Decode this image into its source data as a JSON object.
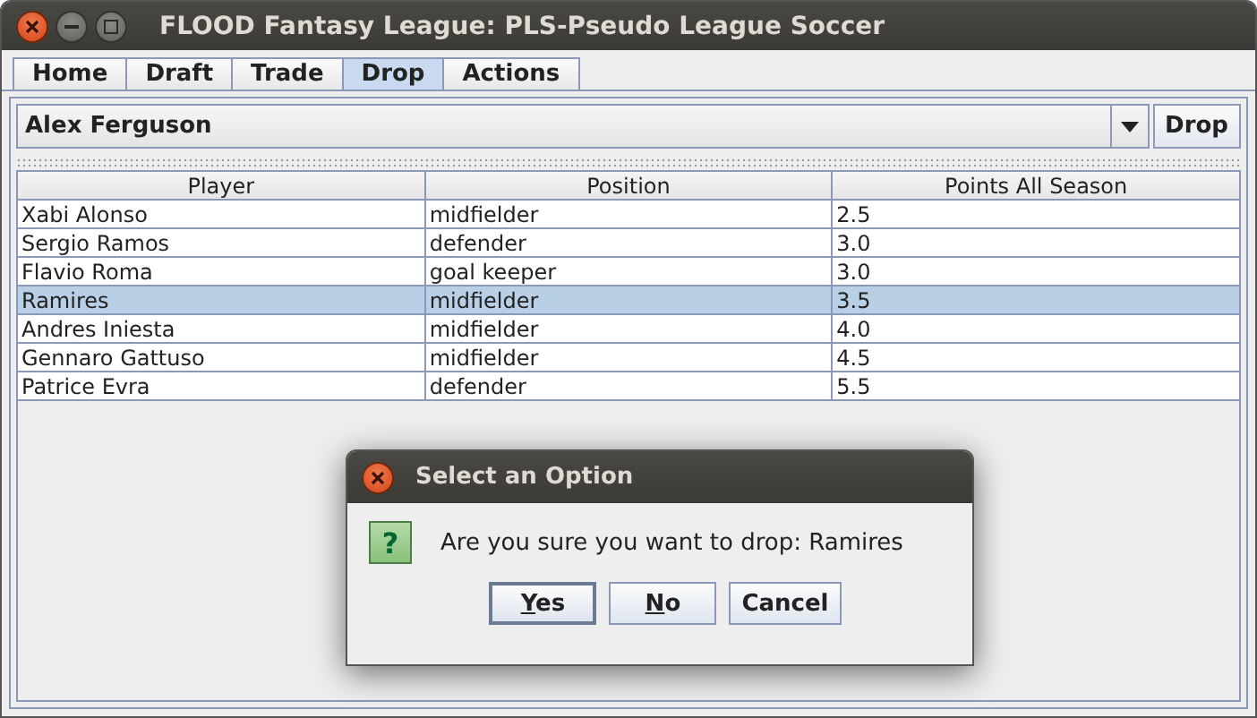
{
  "window": {
    "title": "FLOOD Fantasy League: PLS-Pseudo League Soccer"
  },
  "tabs": [
    {
      "label": "Home",
      "selected": false
    },
    {
      "label": "Draft",
      "selected": false
    },
    {
      "label": "Trade",
      "selected": false
    },
    {
      "label": "Drop",
      "selected": true
    },
    {
      "label": "Actions",
      "selected": false
    }
  ],
  "manager_select": {
    "value": "Alex Ferguson"
  },
  "drop_button": "Drop",
  "table": {
    "columns": [
      "Player",
      "Position",
      "Points All Season"
    ],
    "rows": [
      {
        "cells": [
          "Xabi Alonso",
          "midfielder",
          "2.5"
        ],
        "selected": false
      },
      {
        "cells": [
          "Sergio Ramos",
          "defender",
          "3.0"
        ],
        "selected": false
      },
      {
        "cells": [
          "Flavio Roma",
          "goal keeper",
          "3.0"
        ],
        "selected": false
      },
      {
        "cells": [
          "Ramires",
          "midfielder",
          "3.5"
        ],
        "selected": true
      },
      {
        "cells": [
          "Andres Iniesta",
          "midfielder",
          "4.0"
        ],
        "selected": false
      },
      {
        "cells": [
          "Gennaro Gattuso",
          "midfielder",
          "4.5"
        ],
        "selected": false
      },
      {
        "cells": [
          "Patrice Evra",
          "defender",
          "5.5"
        ],
        "selected": false
      }
    ]
  },
  "dialog": {
    "title": "Select an Option",
    "icon": "?",
    "message": "Are you sure you want to drop: Ramires",
    "buttons": [
      {
        "label": "Yes",
        "mnemonic": true,
        "default": true
      },
      {
        "label": "No",
        "mnemonic": true,
        "default": false
      },
      {
        "label": "Cancel",
        "mnemonic": false,
        "default": false
      }
    ]
  }
}
